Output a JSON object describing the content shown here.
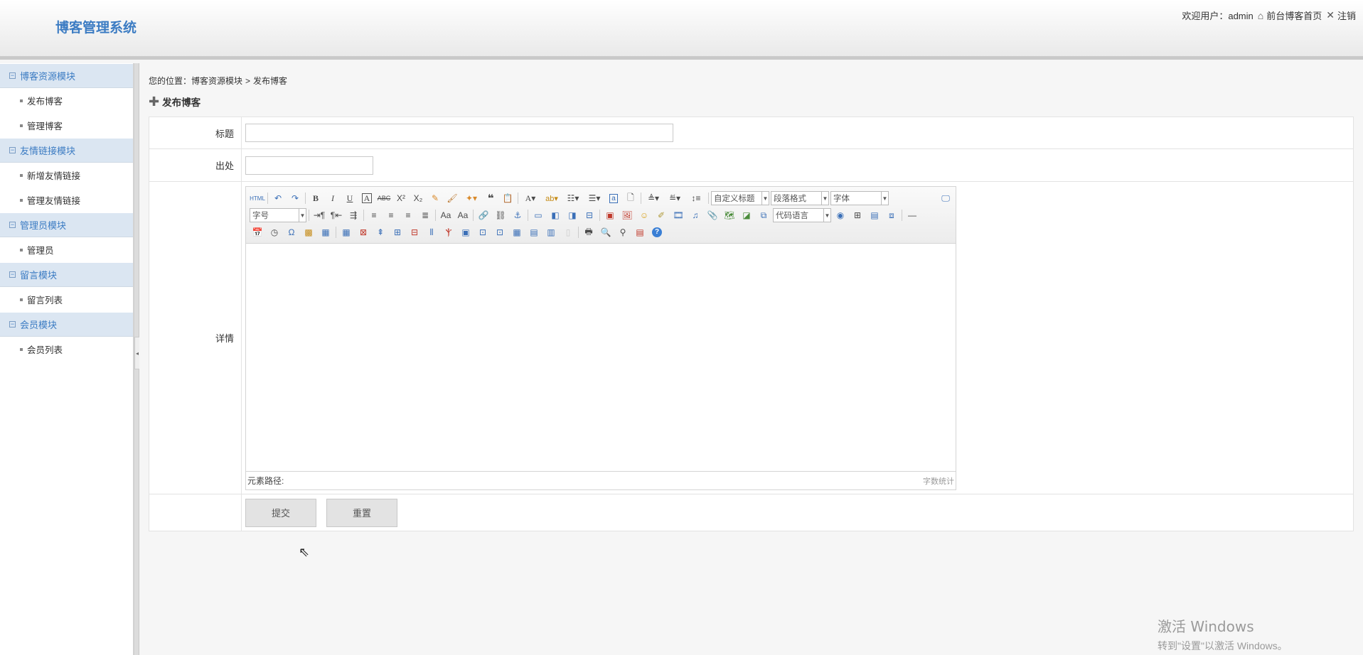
{
  "header": {
    "logo": "博客管理系统",
    "welcome": "欢迎用户：admin",
    "home_link": "前台博客首页",
    "logout_link": "注销"
  },
  "sidebar": {
    "groups": [
      {
        "label": "博客资源模块",
        "items": [
          "发布博客",
          "管理博客"
        ]
      },
      {
        "label": "友情链接模块",
        "items": [
          "新增友情链接",
          "管理友情链接"
        ]
      },
      {
        "label": "管理员模块",
        "items": [
          "管理员"
        ]
      },
      {
        "label": "留言模块",
        "items": [
          "留言列表"
        ]
      },
      {
        "label": "会员模块",
        "items": [
          "会员列表"
        ]
      }
    ]
  },
  "breadcrumb": {
    "prefix": "您的位置：",
    "section": "博客资源模块",
    "sep": ">",
    "current": "发布博客"
  },
  "page_title": "发布博客",
  "form": {
    "title_label": "标题",
    "title_value": "",
    "source_label": "出处",
    "source_value": "",
    "detail_label": "详情",
    "submit": "提交",
    "reset": "重置"
  },
  "editor": {
    "selects": {
      "custom_title": "自定义标题",
      "paragraph": "段落格式",
      "font": "字体",
      "font_size": "字号",
      "code_lang": "代码语言"
    },
    "element_path": "元素路径:",
    "word_count": "字数统计",
    "icons_row1": [
      "html-icon",
      "undo-icon",
      "redo-icon",
      "bold-icon",
      "italic-icon",
      "underline-icon",
      "fontborder-icon",
      "strikethrough-icon",
      "superscript-icon",
      "subscript-icon",
      "removeformat-icon",
      "formatmatch-icon",
      "autotypeset-icon",
      "blockquote-icon",
      "pasteplain-icon",
      "forecolor-icon",
      "backcolor-icon",
      "ordered-list-icon",
      "unordered-list-icon",
      "selectall-icon",
      "cleardoc-icon",
      "rowspacingtop-icon",
      "rowspacingbottom-icon",
      "lineheight-icon",
      "fullscreen-icon"
    ],
    "icons_row2": [
      "ltr-icon",
      "rtl-icon",
      "indent-icon",
      "justify-left-icon",
      "justify-center-icon",
      "justify-right-icon",
      "justify-full-icon",
      "touppercase-icon",
      "tolowercase-icon",
      "link-icon",
      "unlink-icon",
      "anchor-icon",
      "imagenone-icon",
      "imageleft-icon",
      "imageright-icon",
      "imagecenter-icon",
      "simpleupload-icon",
      "insertimage-icon",
      "emotion-icon",
      "scrawl-icon",
      "insertvideo-icon",
      "music-icon",
      "attachment-icon",
      "map-icon",
      "gmap-icon",
      "insertframe-icon",
      "insertcode-icon",
      "webapp-icon",
      "pagebreak-icon",
      "template-icon",
      "background-icon",
      "horizontal-icon"
    ],
    "icons_row3": [
      "date-icon",
      "time-icon",
      "spechars-icon",
      "snapscreen-icon",
      "wordimage-icon",
      "inserttable-icon",
      "deletetable-icon",
      "insertparagraphbeforetable-icon",
      "insertrow-icon",
      "deleterow-icon",
      "insertcol-icon",
      "deletecol-icon",
      "mergecells-icon",
      "mergeright-icon",
      "mergedown-icon",
      "splittocells-icon",
      "splittorows-icon",
      "splittocols-icon",
      "charts-icon",
      "print-icon",
      "preview-icon",
      "searchreplace-icon",
      "drafts-icon",
      "help-icon"
    ]
  },
  "watermark": {
    "line1": "激活 Windows",
    "line2": "转到\"设置\"以激活 Windows。"
  }
}
